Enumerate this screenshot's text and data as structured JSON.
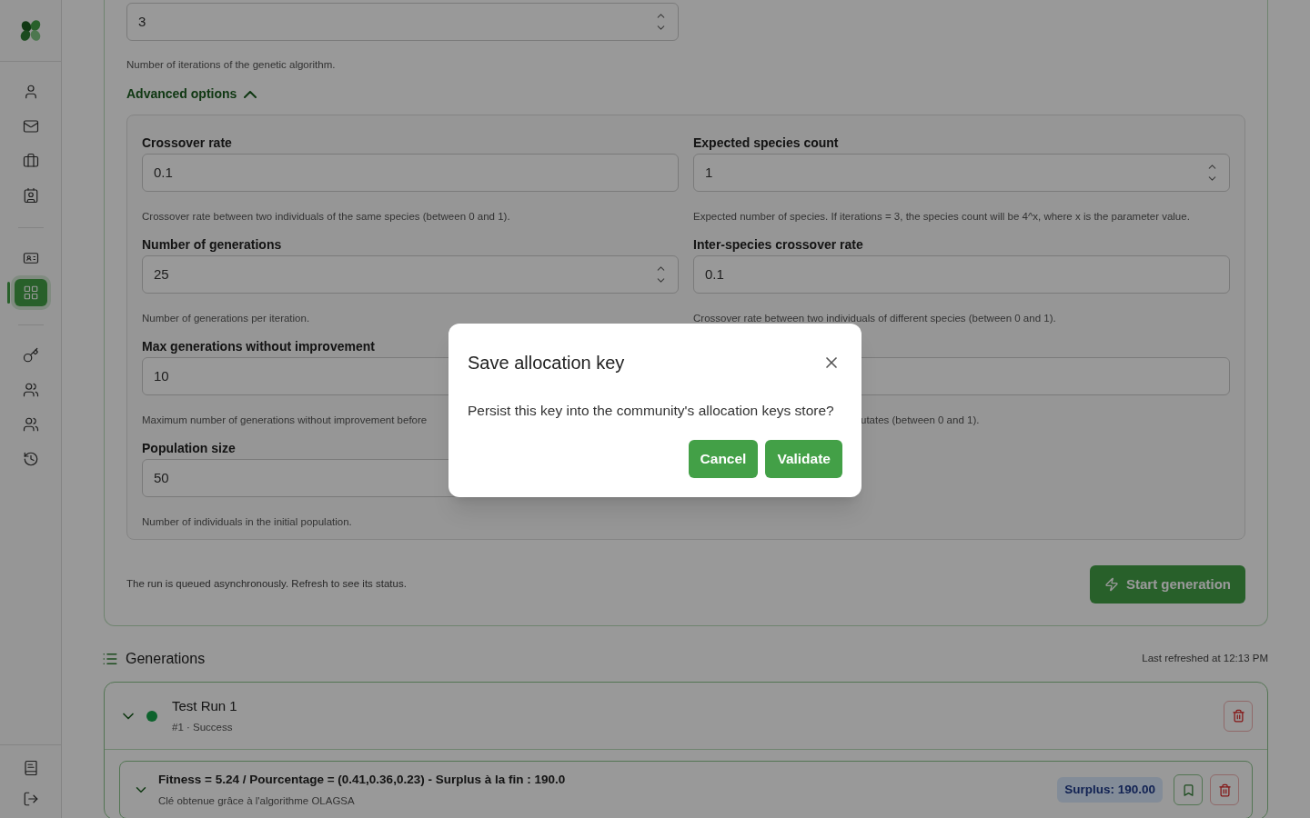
{
  "sidebar": {
    "groups": [
      [
        {
          "selected": false
        },
        {
          "selected": false
        },
        {
          "selected": false
        },
        {
          "selected": false
        }
      ],
      [
        {
          "selected": false
        },
        {
          "selected": true
        }
      ],
      [
        {
          "selected": false
        },
        {
          "selected": false
        },
        {
          "selected": false
        },
        {
          "selected": false
        }
      ]
    ],
    "bottom": [
      {
        "selected": false
      },
      {
        "selected": false
      }
    ]
  },
  "iterations": {
    "value": "3",
    "kind": "number",
    "hint": "Number of iterations of the genetic algorithm."
  },
  "advanced": {
    "label": "Advanced options",
    "expanded": true,
    "left": [
      {
        "label": "Crossover rate",
        "value": "0.1",
        "kind": "text",
        "hint": "Crossover rate between two individuals of the same species (between 0 and 1)."
      },
      {
        "label": "Number of generations",
        "value": "25",
        "kind": "number",
        "hint": "Number of generations per iteration."
      },
      {
        "label": "Max generations without improvement",
        "value": "10",
        "kind": "text",
        "hint": "Maximum number of generations without improvement before"
      },
      {
        "label": "Population size",
        "value": "50",
        "kind": "text",
        "hint": "Number of individuals in the initial population."
      }
    ],
    "right": [
      {
        "label": "Expected species count",
        "value": "1",
        "kind": "number",
        "hint": "Expected number of species. If iterations = 3, the species count will be 4^x, where x is the parameter value."
      },
      {
        "label": "Inter-species crossover rate",
        "value": "0.1",
        "kind": "text",
        "hint": "Crossover rate between two individuals of different species (between 0 and 1)."
      },
      {
        "kind": "text",
        "hint": "utates (between 0 and 1)."
      }
    ]
  },
  "footer_note": "The run is queued asynchronously. Refresh to see its status.",
  "start_button": "Start generation",
  "generations": {
    "title": "Generations",
    "refreshed": "Last refreshed at 12:13 PM",
    "runs": [
      {
        "name": "Test Run 1",
        "meta": "#1 · Success",
        "succeeded": true,
        "expanded": true,
        "results": [
          {
            "title": "Fitness = 5.24 / Pourcentage = (0.41,0.36,0.23) - Surplus à la fin : 190.0",
            "subtitle": "Clé obtenue grâce à l'algorithme OLAGSA",
            "badge": "Surplus: 190.00",
            "expanded": true
          }
        ]
      }
    ]
  },
  "dialog": {
    "title": "Save allocation key",
    "message": "Persist this key into the community's allocation keys store?",
    "buttons": [
      "Cancel",
      "Validate"
    ]
  }
}
